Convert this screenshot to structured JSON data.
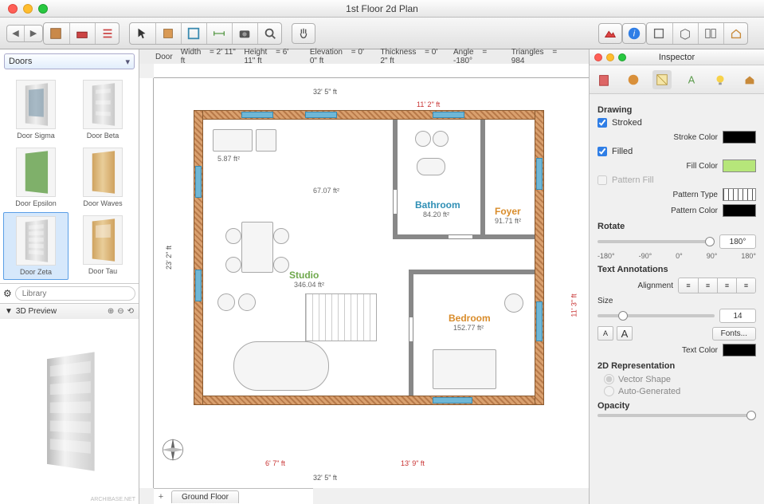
{
  "window": {
    "title": "1st Floor 2d Plan"
  },
  "library": {
    "dropdown": "Doors",
    "search_placeholder": "Library",
    "items": [
      {
        "name": "Door Sigma"
      },
      {
        "name": "Door Beta"
      },
      {
        "name": "Door Epsilon"
      },
      {
        "name": "Door Waves"
      },
      {
        "name": "Door Zeta"
      },
      {
        "name": "Door Tau"
      }
    ],
    "preview_title": "3D Preview"
  },
  "info": {
    "object": "Door",
    "width_label": "Width",
    "width": "2' 11\" ft",
    "height_label": "Height",
    "height": "6' 11\" ft",
    "elevation_label": "Elevation",
    "elevation": "0' 0\" ft",
    "thickness_label": "Thickness",
    "thickness": "0' 2\" ft",
    "angle_label": "Angle",
    "angle": "-180°",
    "triangles_label": "Triangles",
    "triangles": "984"
  },
  "plan": {
    "floor_tab": "Ground Floor",
    "rooms": {
      "studio": {
        "name": "Studio",
        "area": "346.04 ft²",
        "color": "#6fa84c"
      },
      "bathroom": {
        "name": "Bathroom",
        "area": "84.20 ft²",
        "color": "#2f8fb5"
      },
      "foyer": {
        "name": "Foyer",
        "area": "91.71 ft²",
        "color": "#d98c2a"
      },
      "bedroom": {
        "name": "Bedroom",
        "area": "152.77 ft²",
        "color": "#d98c2a"
      }
    },
    "misc_area": "67.07 ft²",
    "small_dim": "5.87 ft²",
    "dims": {
      "top_outer": "32' 5\" ft",
      "top_inner": "11' 2\" ft",
      "left": "23' 2\" ft",
      "right": "11' 3\" ft",
      "bottom_outer": "32' 5\" ft",
      "bottom_left": "6' 7\" ft",
      "bottom_right": "13' 9\" ft"
    }
  },
  "inspector": {
    "title": "Inspector",
    "sections": {
      "drawing": "Drawing",
      "stroked": "Stroked",
      "stroke_color_label": "Stroke Color",
      "filled": "Filled",
      "fill_color_label": "Fill Color",
      "pattern_fill": "Pattern Fill",
      "pattern_type": "Pattern Type",
      "pattern_color": "Pattern Color",
      "rotate": "Rotate",
      "rotate_value": "180°",
      "rotate_ticks": [
        "-180°",
        "-90°",
        "0°",
        "90°",
        "180°"
      ],
      "text_annotations": "Text Annotations",
      "alignment": "Alignment",
      "size": "Size",
      "size_value": "14",
      "fonts_btn": "Fonts...",
      "text_color": "Text Color",
      "rep2d": "2D Representation",
      "vector": "Vector Shape",
      "autogen": "Auto-Generated",
      "opacity": "Opacity"
    },
    "colors": {
      "stroke": "#000000",
      "fill": "#b6e67a",
      "pattern": "#000000",
      "text": "#000000"
    }
  }
}
